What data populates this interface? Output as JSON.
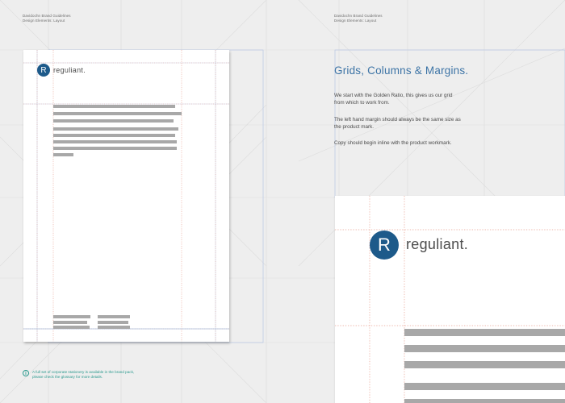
{
  "header_left": {
    "line1": "Davidochn Brand Guidelines",
    "line2": "Design Elements: Layout"
  },
  "header_right": {
    "line1": "Davidochn Brand Guidelines",
    "line2": "Design Elements: Layout"
  },
  "logo": {
    "mark_letter": "R",
    "wordmark": "reguliant."
  },
  "heading": "Grids, Columns & Margins.",
  "paragraphs": [
    "We start with the Golden Ratio, this gives us our grid from which to work from.",
    "The left hand margin should always be the same size as the product mark.",
    "Copy should begin inline with the product workmark."
  ],
  "footnote": "A full set of corporate stationery is available in the brand pack, please check the glossary for more details.",
  "colors": {
    "brand_blue": "#1d5a8a",
    "heading_blue": "#3d74a6",
    "guide_red": "#e8a090",
    "guide_blue": "#7f9fd0",
    "note_teal": "#2b9a8e",
    "text_bar": "#a8a8a8"
  },
  "icons": {
    "note": "info-icon"
  }
}
